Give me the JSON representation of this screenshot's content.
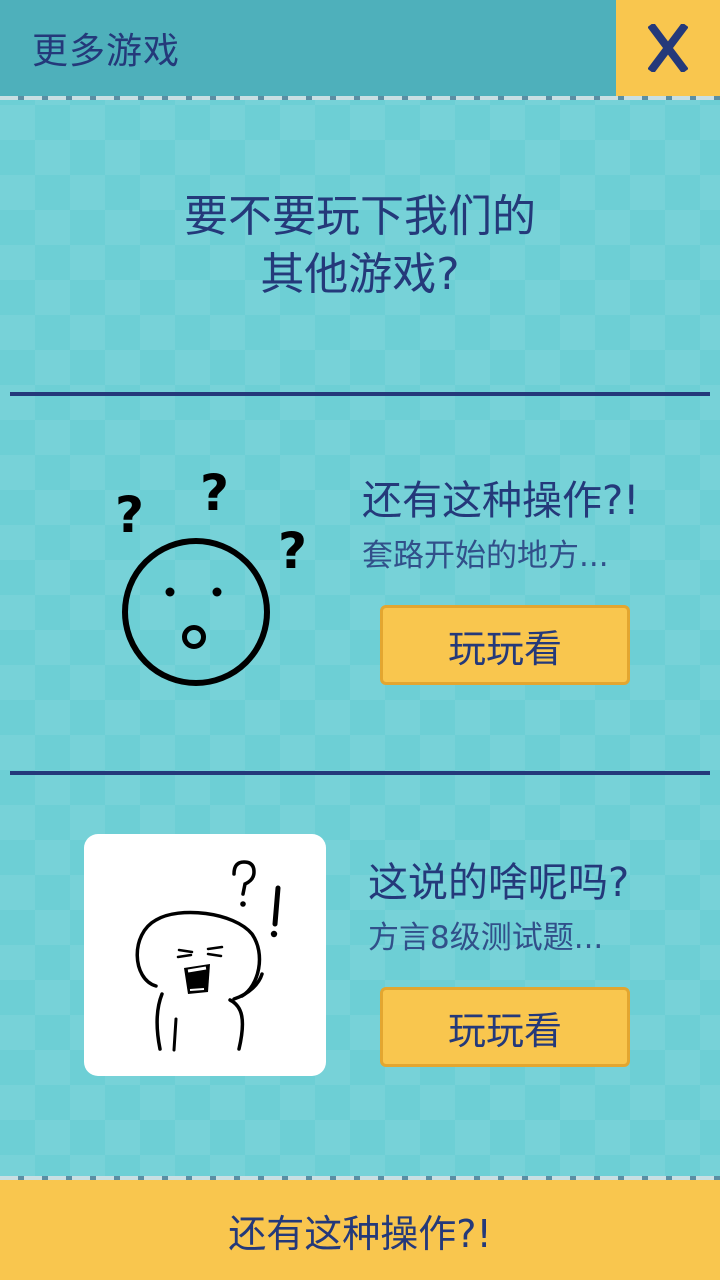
{
  "header": {
    "title": "更多游戏",
    "close_label": "X"
  },
  "prompt": {
    "line1": "要不要玩下我们的",
    "line2": "其他游戏?"
  },
  "games": [
    {
      "title": "还有这种操作?!",
      "subtitle": "套路开始的地方...",
      "button_label": "玩玩看",
      "icon": "question-face-icon"
    },
    {
      "title": "这说的啥呢吗?",
      "subtitle": "方言8级测试题...",
      "button_label": "玩玩看",
      "icon": "confused-character-thumbnail"
    }
  ],
  "footer": {
    "label": "还有这种操作?!"
  },
  "colors": {
    "background": "#6dcfd5",
    "header": "#4eb0bb",
    "accent_yellow": "#f9c64e",
    "text_navy": "#24397a"
  }
}
